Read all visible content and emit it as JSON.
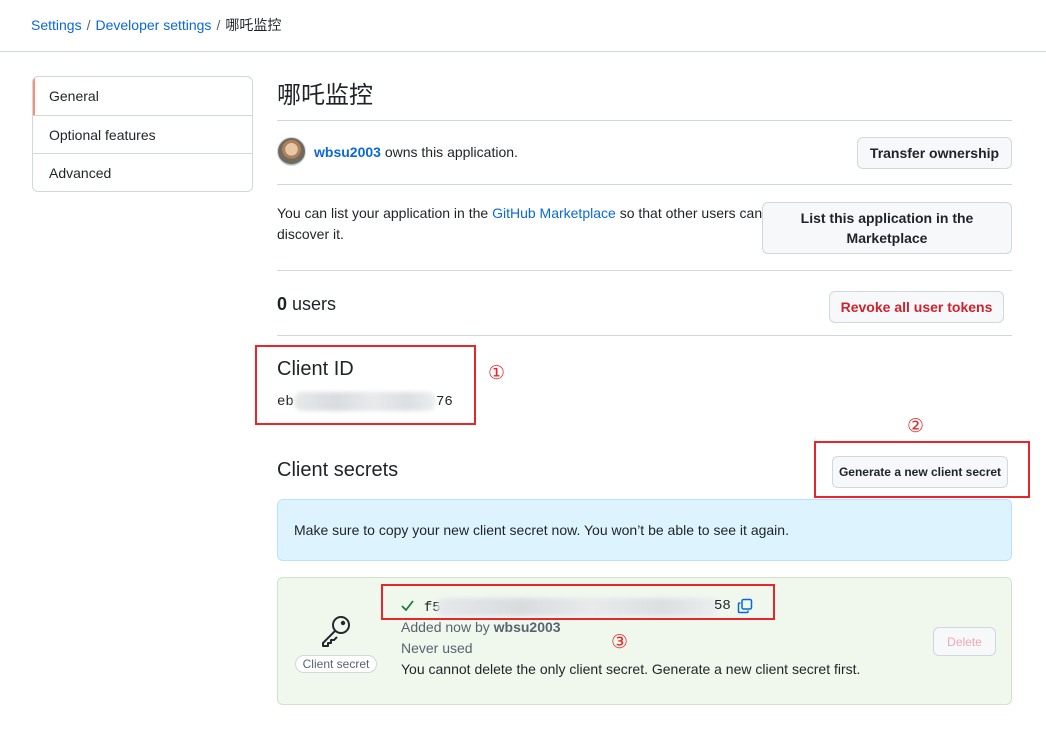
{
  "breadcrumb": {
    "settings": "Settings",
    "developer_settings": "Developer settings",
    "current": "哪吒监控",
    "separator": "/"
  },
  "sidebar": {
    "items": [
      {
        "label": "General",
        "active": true
      },
      {
        "label": "Optional features",
        "active": false
      },
      {
        "label": "Advanced",
        "active": false
      }
    ]
  },
  "app": {
    "title": "哪吒监控",
    "owner_login": "wbsu2003",
    "owner_suffix": "owns this application.",
    "transfer_button": "Transfer ownership"
  },
  "marketplace": {
    "text_before": "You can list your application in the",
    "link": "GitHub Marketplace",
    "text_after": "so that other users can discover it.",
    "button": "List this application in the Marketplace"
  },
  "users": {
    "count": "0",
    "label": "users",
    "revoke_button": "Revoke all user tokens"
  },
  "client_id": {
    "heading": "Client ID",
    "prefix": "eb",
    "suffix": "76"
  },
  "client_secrets": {
    "heading": "Client secrets",
    "generate_button": "Generate a new client secret",
    "flash": "Make sure to copy your new client secret now. You won’t be able to see it again.",
    "secret": {
      "badge": "Client secret",
      "prefix": "f5",
      "suffix": "58",
      "added_prefix": "Added now by",
      "added_by": "wbsu2003",
      "usage": "Never used",
      "warning": "You cannot delete the only client secret. Generate a new client secret first.",
      "delete_button": "Delete"
    }
  },
  "annotations": [
    "①",
    "②",
    "③"
  ],
  "colors": {
    "link": "#0969da",
    "danger": "#cf222e",
    "annotation": "#e8252a",
    "flash_bg": "#ddf4ff",
    "success_bg": "#f0f8ee",
    "nav_accent": "#fd8c73"
  }
}
